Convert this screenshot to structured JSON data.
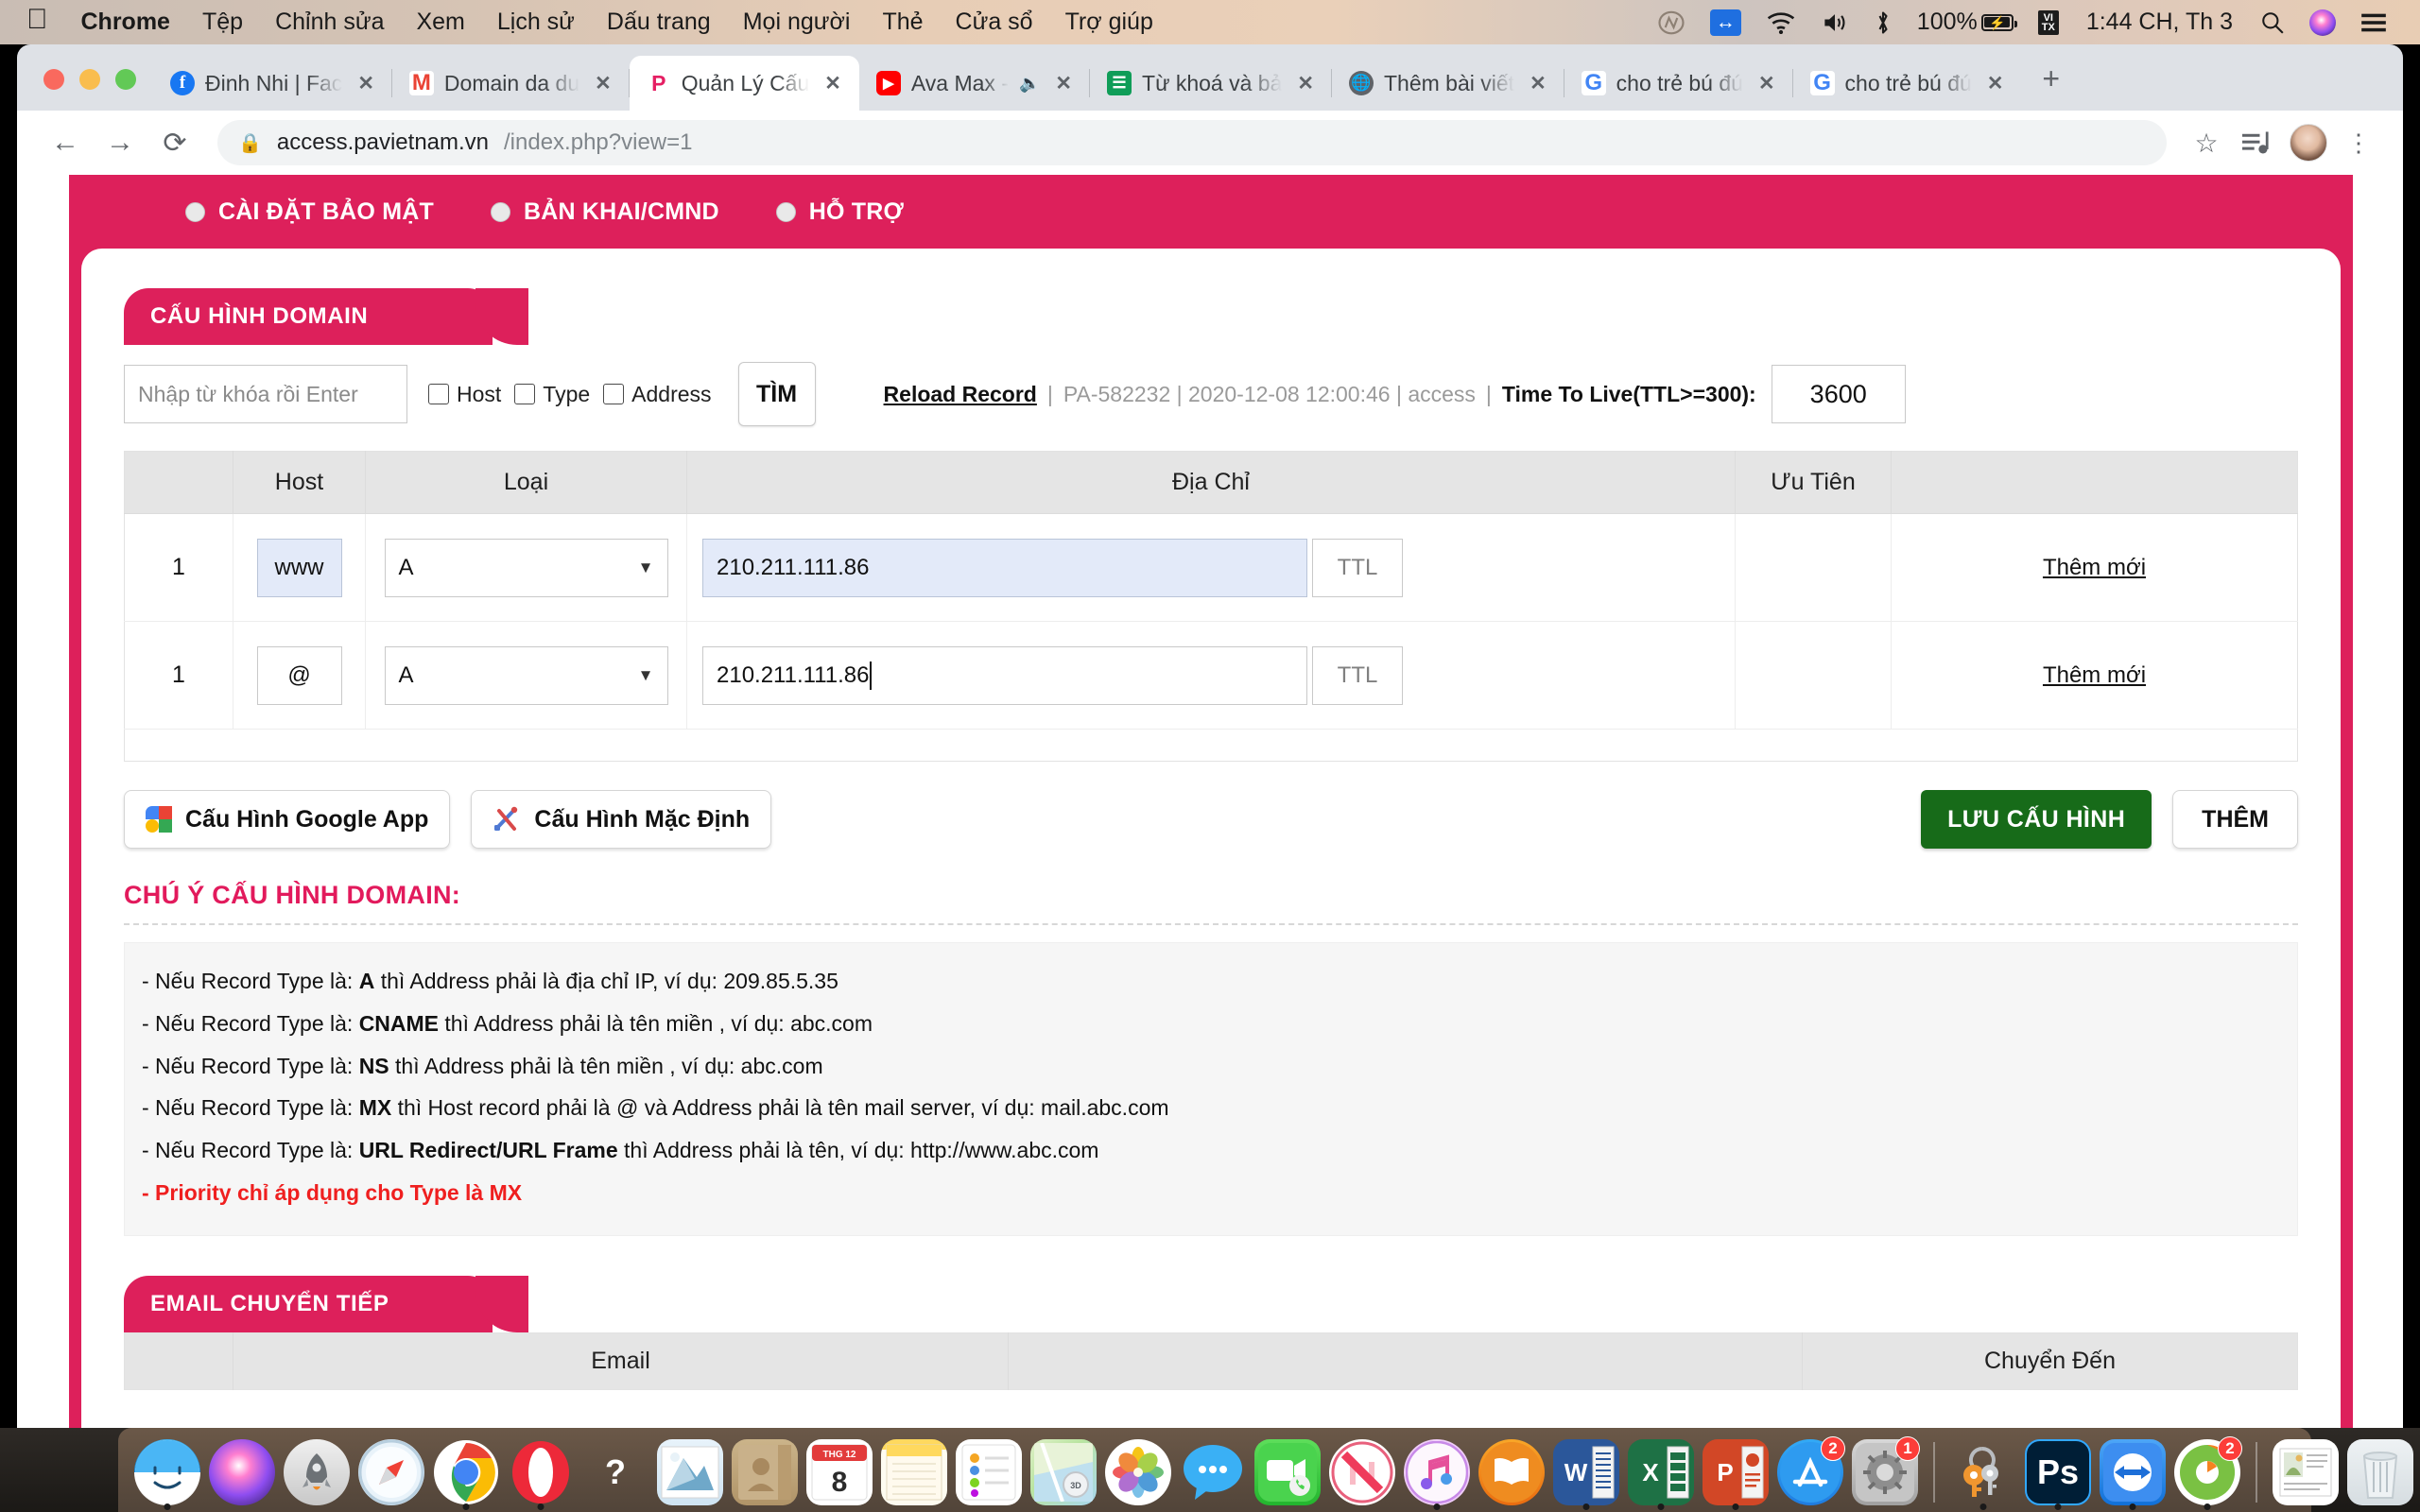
{
  "menubar": {
    "apple": "apple-logo",
    "items": [
      "Chrome",
      "Tệp",
      "Chỉnh sửa",
      "Xem",
      "Lịch sử",
      "Dấu trang",
      "Mọi người",
      "Thẻ",
      "Cửa sổ",
      "Trợ giúp"
    ],
    "battery_percent": "100%",
    "clock": "1:44 CH, Th 3",
    "vtx": "VI\nTX"
  },
  "browser": {
    "tabs": [
      {
        "title": "Đinh Nhi | Fac",
        "favicon": "facebook-icon",
        "active": false,
        "muted": false
      },
      {
        "title": "Domain da du",
        "favicon": "gmail-icon",
        "active": false,
        "muted": false
      },
      {
        "title": "Quản Lý Cấu",
        "favicon": "pavietnam-icon",
        "active": true,
        "muted": false
      },
      {
        "title": "Ava Max -",
        "favicon": "youtube-icon",
        "active": false,
        "muted": true
      },
      {
        "title": "Từ khoá và bả",
        "favicon": "google-sheets-icon",
        "active": false,
        "muted": false
      },
      {
        "title": "Thêm bài viết",
        "favicon": "globe-icon",
        "active": false,
        "muted": false
      },
      {
        "title": "cho trẻ bú đú",
        "favicon": "google-icon",
        "active": false,
        "muted": false
      },
      {
        "title": "cho trẻ bú đú",
        "favicon": "google-icon",
        "active": false,
        "muted": false
      }
    ],
    "new_tab_label": "+",
    "close_label": "✕",
    "url_host": "access.pavietnam.vn",
    "url_path": "/index.php?view=1"
  },
  "page": {
    "top_nav": [
      {
        "label": "CÀI ĐẶT BẢO MẬT"
      },
      {
        "label": "BẢN KHAI/CMND"
      },
      {
        "label": "HỖ TRỢ"
      }
    ],
    "domain_section": {
      "title": "CẤU HÌNH DOMAIN",
      "search_placeholder": "Nhập từ khóa rồi Enter",
      "search_value": "",
      "checkboxes": [
        {
          "label": "Host",
          "checked": false
        },
        {
          "label": "Type",
          "checked": false
        },
        {
          "label": "Address",
          "checked": false
        }
      ],
      "search_button": "TÌM",
      "reload_link": "Reload Record",
      "meta_sep": "|",
      "meta_info": "PA-582232 | 2020-12-08 12:00:46 | access",
      "ttl_label": "Time To Live(TTL>=300):",
      "ttl_value": "3600",
      "table": {
        "headers": [
          "",
          "Host",
          "Loại",
          "Địa Chỉ",
          "Ưu Tiên",
          ""
        ],
        "rows": [
          {
            "index": "1",
            "host": "www",
            "host_selected": true,
            "type": "A",
            "address": "210.211.111.86",
            "address_selected": true,
            "address_focused": false,
            "ttl_placeholder": "TTL",
            "priority": "",
            "action": "Thêm mới"
          },
          {
            "index": "1",
            "host": "@",
            "host_selected": false,
            "type": "A",
            "address": "210.211.111.86",
            "address_selected": false,
            "address_focused": true,
            "ttl_placeholder": "TTL",
            "priority": "",
            "action": "Thêm mới"
          }
        ]
      },
      "buttons": {
        "google_app": "Cấu Hình Google App",
        "default_config": "Cấu Hình Mặc Định",
        "save": "LƯU CẤU HÌNH",
        "add": "THÊM"
      }
    },
    "notes": {
      "title": "CHÚ Ý CẤU HÌNH DOMAIN:",
      "lines": [
        {
          "prefix": "-  Nếu Record Type là: ",
          "bold": "A",
          "rest": " thì Address phải là địa chỉ IP, ví dụ: 209.85.5.35",
          "warn": false
        },
        {
          "prefix": "-  Nếu Record Type là: ",
          "bold": "CNAME",
          "rest": " thì Address phải là tên miền , ví dụ: abc.com",
          "warn": false
        },
        {
          "prefix": "-  Nếu Record Type là: ",
          "bold": "NS",
          "rest": " thì Address phải là tên miền , ví dụ: abc.com",
          "warn": false
        },
        {
          "prefix": "-  Nếu Record Type là: ",
          "bold": "MX",
          "rest": " thì Host record phải là @ và Address phải là tên mail server, ví dụ: mail.abc.com",
          "warn": false
        },
        {
          "prefix": "-  Nếu Record Type là: ",
          "bold": "URL Redirect/URL Frame",
          "rest": " thì Address phải là tên, ví dụ: http://www.abc.com",
          "warn": false
        },
        {
          "prefix": "-  Priority chỉ áp dụng cho Type là MX",
          "bold": "",
          "rest": "",
          "warn": true
        }
      ]
    },
    "email_section": {
      "title": "EMAIL CHUYỂN TIẾP",
      "headers": [
        "",
        "Email",
        "",
        "Chuyển Đến"
      ]
    }
  },
  "dock": {
    "items": [
      {
        "name": "finder",
        "label": "F",
        "running": true,
        "badge": ""
      },
      {
        "name": "siri",
        "label": "",
        "running": false,
        "badge": ""
      },
      {
        "name": "launchpad",
        "label": "",
        "running": false,
        "badge": ""
      },
      {
        "name": "safari",
        "label": "",
        "running": false,
        "badge": ""
      },
      {
        "name": "chrome",
        "label": "",
        "running": true,
        "badge": ""
      },
      {
        "name": "opera",
        "label": "O",
        "running": true,
        "badge": ""
      },
      {
        "name": "help",
        "label": "?",
        "running": false,
        "badge": ""
      },
      {
        "name": "mail",
        "label": "",
        "running": false,
        "badge": ""
      },
      {
        "name": "contacts",
        "label": "",
        "running": false,
        "badge": ""
      },
      {
        "name": "calendar",
        "label": "8",
        "running": false,
        "badge": "",
        "month": "THG 12"
      },
      {
        "name": "notes",
        "label": "",
        "running": false,
        "badge": ""
      },
      {
        "name": "reminders",
        "label": "",
        "running": false,
        "badge": ""
      },
      {
        "name": "maps",
        "label": "",
        "running": false,
        "badge": ""
      },
      {
        "name": "photos",
        "label": "",
        "running": false,
        "badge": ""
      },
      {
        "name": "messages",
        "label": "",
        "running": false,
        "badge": ""
      },
      {
        "name": "facetime",
        "label": "",
        "running": false,
        "badge": ""
      },
      {
        "name": "news",
        "label": "",
        "running": false,
        "badge": ""
      },
      {
        "name": "itunes",
        "label": "",
        "running": true,
        "badge": ""
      },
      {
        "name": "books",
        "label": "",
        "running": false,
        "badge": ""
      },
      {
        "name": "word",
        "label": "W",
        "running": true,
        "badge": ""
      },
      {
        "name": "excel",
        "label": "X",
        "running": true,
        "badge": ""
      },
      {
        "name": "powerpoint",
        "label": "P",
        "running": true,
        "badge": ""
      },
      {
        "name": "app-store",
        "label": "",
        "running": false,
        "badge": "2"
      },
      {
        "name": "system-preferences",
        "label": "",
        "running": false,
        "badge": "1"
      },
      {
        "name": "keychain-access",
        "label": "",
        "running": true,
        "badge": ""
      },
      {
        "name": "photoshop",
        "label": "Ps",
        "running": true,
        "badge": ""
      },
      {
        "name": "teamviewer",
        "label": "",
        "running": true,
        "badge": ""
      },
      {
        "name": "ccleaner",
        "label": "",
        "running": true,
        "badge": "2"
      },
      {
        "name": "document",
        "label": "",
        "running": false,
        "badge": ""
      },
      {
        "name": "trash",
        "label": "",
        "running": false,
        "badge": ""
      }
    ]
  },
  "colors": {
    "brand_pink": "#dd205b",
    "accent_pink": "#e21a5c",
    "save_green": "#176b19",
    "warn_red": "#ef1f1f",
    "selected_blue": "#e3eaf9"
  }
}
